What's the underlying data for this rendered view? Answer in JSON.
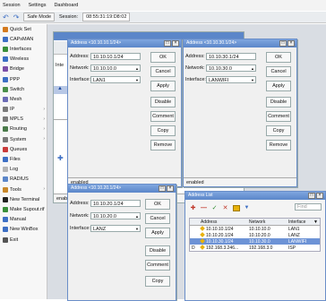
{
  "menubar": {
    "items": [
      "Session",
      "Settings",
      "Dashboard"
    ]
  },
  "toolbar": {
    "safe_mode": "Safe Mode",
    "session_label": "Session:",
    "session_value": "08:55:31:19:D8:02"
  },
  "sidebar": {
    "items": [
      {
        "label": "Quick Set",
        "icon": "quick-set-icon",
        "color": "#d47a1e",
        "arrow": false
      },
      {
        "label": "CAPsMAN",
        "icon": "capsman-icon",
        "color": "#3d6fc4",
        "arrow": false
      },
      {
        "label": "Interfaces",
        "icon": "interfaces-icon",
        "color": "#3a8f3a",
        "arrow": false
      },
      {
        "label": "Wireless",
        "icon": "wireless-icon",
        "color": "#3a6fc4",
        "arrow": false
      },
      {
        "label": "Bridge",
        "icon": "bridge-icon",
        "color": "#7b4fa8",
        "arrow": false
      },
      {
        "label": "PPP",
        "icon": "ppp-icon",
        "color": "#3d6fc4",
        "arrow": false
      },
      {
        "label": "Switch",
        "icon": "switch-icon",
        "color": "#4a8f4a",
        "arrow": false
      },
      {
        "label": "Mesh",
        "icon": "mesh-icon",
        "color": "#6b6bb5",
        "arrow": false
      },
      {
        "label": "IP",
        "icon": "ip-icon",
        "color": "#7a7a7a",
        "arrow": true
      },
      {
        "label": "MPLS",
        "icon": "mpls-icon",
        "color": "#7a7a7a",
        "arrow": true
      },
      {
        "label": "Routing",
        "icon": "routing-icon",
        "color": "#4a7a4a",
        "arrow": true
      },
      {
        "label": "System",
        "icon": "system-icon",
        "color": "#7a7a7a",
        "arrow": true
      },
      {
        "label": "Queues",
        "icon": "queues-icon",
        "color": "#c93a3a",
        "arrow": false
      },
      {
        "label": "Files",
        "icon": "files-icon",
        "color": "#3d6fc4",
        "arrow": false
      },
      {
        "label": "Log",
        "icon": "log-icon",
        "color": "#b5b5b5",
        "arrow": false
      },
      {
        "label": "RADIUS",
        "icon": "radius-icon",
        "color": "#5b86c9",
        "arrow": false
      },
      {
        "label": "Tools",
        "icon": "tools-icon",
        "color": "#c9882a",
        "arrow": true
      },
      {
        "label": "New Terminal",
        "icon": "terminal-icon",
        "color": "#222222",
        "arrow": false
      },
      {
        "label": "Make Supout.rif",
        "icon": "supout-icon",
        "color": "#3a8f3a",
        "arrow": false
      },
      {
        "label": "Manual",
        "icon": "manual-icon",
        "color": "#3d6fc4",
        "arrow": false
      },
      {
        "label": "New WinBox",
        "icon": "winbox-icon",
        "color": "#3d6fc4",
        "arrow": false
      },
      {
        "label": "Exit",
        "icon": "exit-icon",
        "color": "#555555",
        "arrow": false
      }
    ]
  },
  "bg_window": {
    "label_left": "Inte",
    "label_right": "F",
    "status": "enabled"
  },
  "addr1": {
    "title": "Address <10.10.10.1/24>",
    "address_label": "Address:",
    "address_value": "10.10.10.1/24",
    "network_label": "Network:",
    "network_value": "10.10.10.0",
    "interface_label": "Interface:",
    "interface_value": "LAN1",
    "status": "enabled",
    "buttons": [
      "OK",
      "Cancel",
      "Apply",
      "Disable",
      "Comment",
      "Copy",
      "Remove"
    ]
  },
  "addr2": {
    "title": "Address <10.10.30.1/24>",
    "address_label": "Address:",
    "address_value": "10.10.30.1/24",
    "network_label": "Network:",
    "network_value": "10.10.30.0",
    "interface_label": "Interface:",
    "interface_value": "LANWIFI",
    "status": "enabled",
    "buttons": [
      "OK",
      "Cancel",
      "Apply",
      "Disable",
      "Comment",
      "Copy",
      "Remove"
    ]
  },
  "addr3": {
    "title": "Address <10.10.20.1/24>",
    "address_label": "Address:",
    "address_value": "10.10.20.1/24",
    "network_label": "Network:",
    "network_value": "10.10.20.0",
    "interface_label": "Interface:",
    "interface_value": "LANZ",
    "buttons": [
      "OK",
      "Cancel",
      "Apply",
      "Disable",
      "Comment",
      "Copy"
    ]
  },
  "address_list": {
    "title": "Address List",
    "find_placeholder": "Find",
    "columns": [
      "Address",
      "Network",
      "Interface"
    ],
    "rows": [
      {
        "flag": "",
        "address": "10.10.10.1/24",
        "network": "10.10.10.0",
        "interface": "LAN1",
        "selected": false
      },
      {
        "flag": "",
        "address": "10.10.20.1/24",
        "network": "10.10.20.0",
        "interface": "LANZ",
        "selected": false
      },
      {
        "flag": "",
        "address": "10.10.30.1/24",
        "network": "10.10.30.0",
        "interface": "LANWIFI",
        "selected": true
      },
      {
        "flag": "D",
        "address": "192.168.3.246...",
        "network": "192.168.3.0",
        "interface": "ISP",
        "selected": false
      }
    ]
  }
}
